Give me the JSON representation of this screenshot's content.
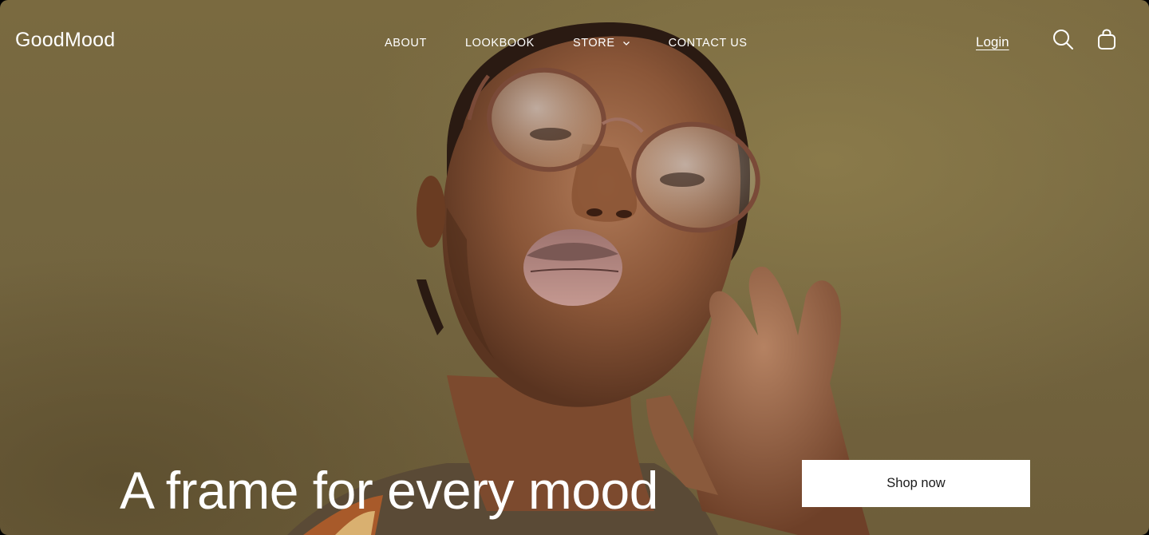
{
  "brand": {
    "name": "GoodMood"
  },
  "nav": {
    "items": [
      {
        "label": "ABOUT"
      },
      {
        "label": "LOOKBOOK"
      },
      {
        "label": "STORE",
        "has_dropdown": true
      },
      {
        "label": "CONTACT US"
      }
    ]
  },
  "header_actions": {
    "login_label": "Login",
    "search_icon": "search-icon",
    "cart_icon": "shopping-bag-icon"
  },
  "hero": {
    "headline": "A frame for every mood",
    "cta_label": "Shop now",
    "image_subject": "woman wearing round tortoiseshell glasses blowing a kiss"
  },
  "colors": {
    "background": "#756640",
    "text": "#ffffff",
    "button_bg": "#ffffff",
    "button_text": "#1a1a1a"
  }
}
